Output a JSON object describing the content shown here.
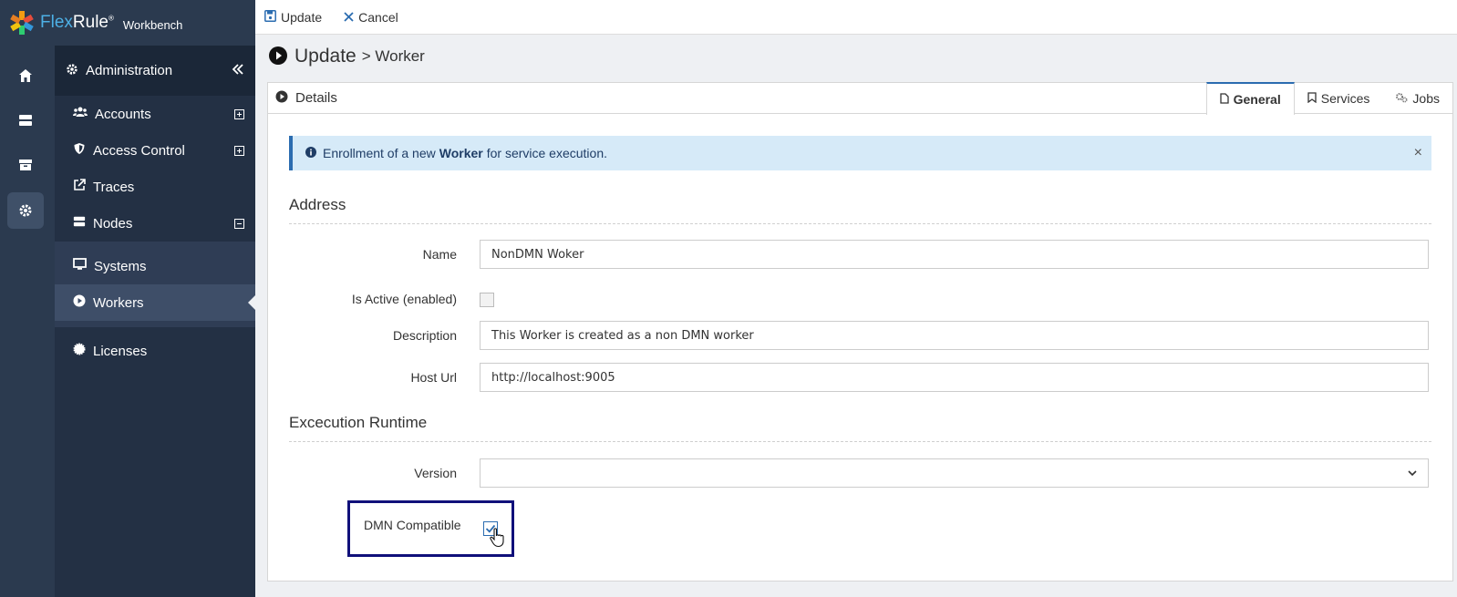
{
  "app": {
    "brand_flex": "Flex",
    "brand_rule": "Rule",
    "brand_reg": "®",
    "workbench": "Workbench"
  },
  "rail": {
    "items": [
      {
        "icon": "home-icon"
      },
      {
        "icon": "server-icon"
      },
      {
        "icon": "archive-icon"
      },
      {
        "icon": "gear-icon",
        "active": true
      }
    ]
  },
  "sidebar": {
    "header": "Administration",
    "items": [
      {
        "label": "Accounts",
        "icon": "users-icon",
        "expand": "plus"
      },
      {
        "label": "Access Control",
        "icon": "shield-icon",
        "expand": "plus"
      },
      {
        "label": "Traces",
        "icon": "external-link-icon"
      },
      {
        "label": "Nodes",
        "icon": "server-icon",
        "expand": "minus"
      }
    ],
    "subitems": [
      {
        "label": "Systems",
        "icon": "monitor-icon"
      },
      {
        "label": "Workers",
        "icon": "play-circle-icon",
        "selected": true
      }
    ],
    "footer_item": {
      "label": "Licenses",
      "icon": "badge-icon"
    }
  },
  "toolbar": {
    "update_label": "Update",
    "cancel_label": "Cancel"
  },
  "page": {
    "title": "Update",
    "subtitle": "> Worker"
  },
  "panel": {
    "header": "Details",
    "tabs": [
      {
        "label": "General",
        "icon": "file-icon",
        "active": true
      },
      {
        "label": "Services",
        "icon": "bookmark-icon"
      },
      {
        "label": "Jobs",
        "icon": "cogs-icon"
      }
    ]
  },
  "alert": {
    "prefix": "Enrollment of a new",
    "bold": "Worker",
    "suffix": "for service execution.",
    "close": "×"
  },
  "address": {
    "section": "Address",
    "name_label": "Name",
    "name_value": "NonDMN Woker",
    "active_label": "Is Active (enabled)",
    "active_checked": false,
    "description_label": "Description",
    "description_value": "This Worker is created as a non DMN worker",
    "host_label": "Host Url",
    "host_value": "http://localhost:9005"
  },
  "runtime": {
    "section": "Excecution Runtime",
    "version_label": "Version",
    "version_value": "",
    "dmn_label": "DMN Compatible",
    "dmn_checked": true
  },
  "colors": {
    "accent": "#2b6cb0",
    "sidebar": "#233044",
    "highlight_box": "#10107a"
  }
}
